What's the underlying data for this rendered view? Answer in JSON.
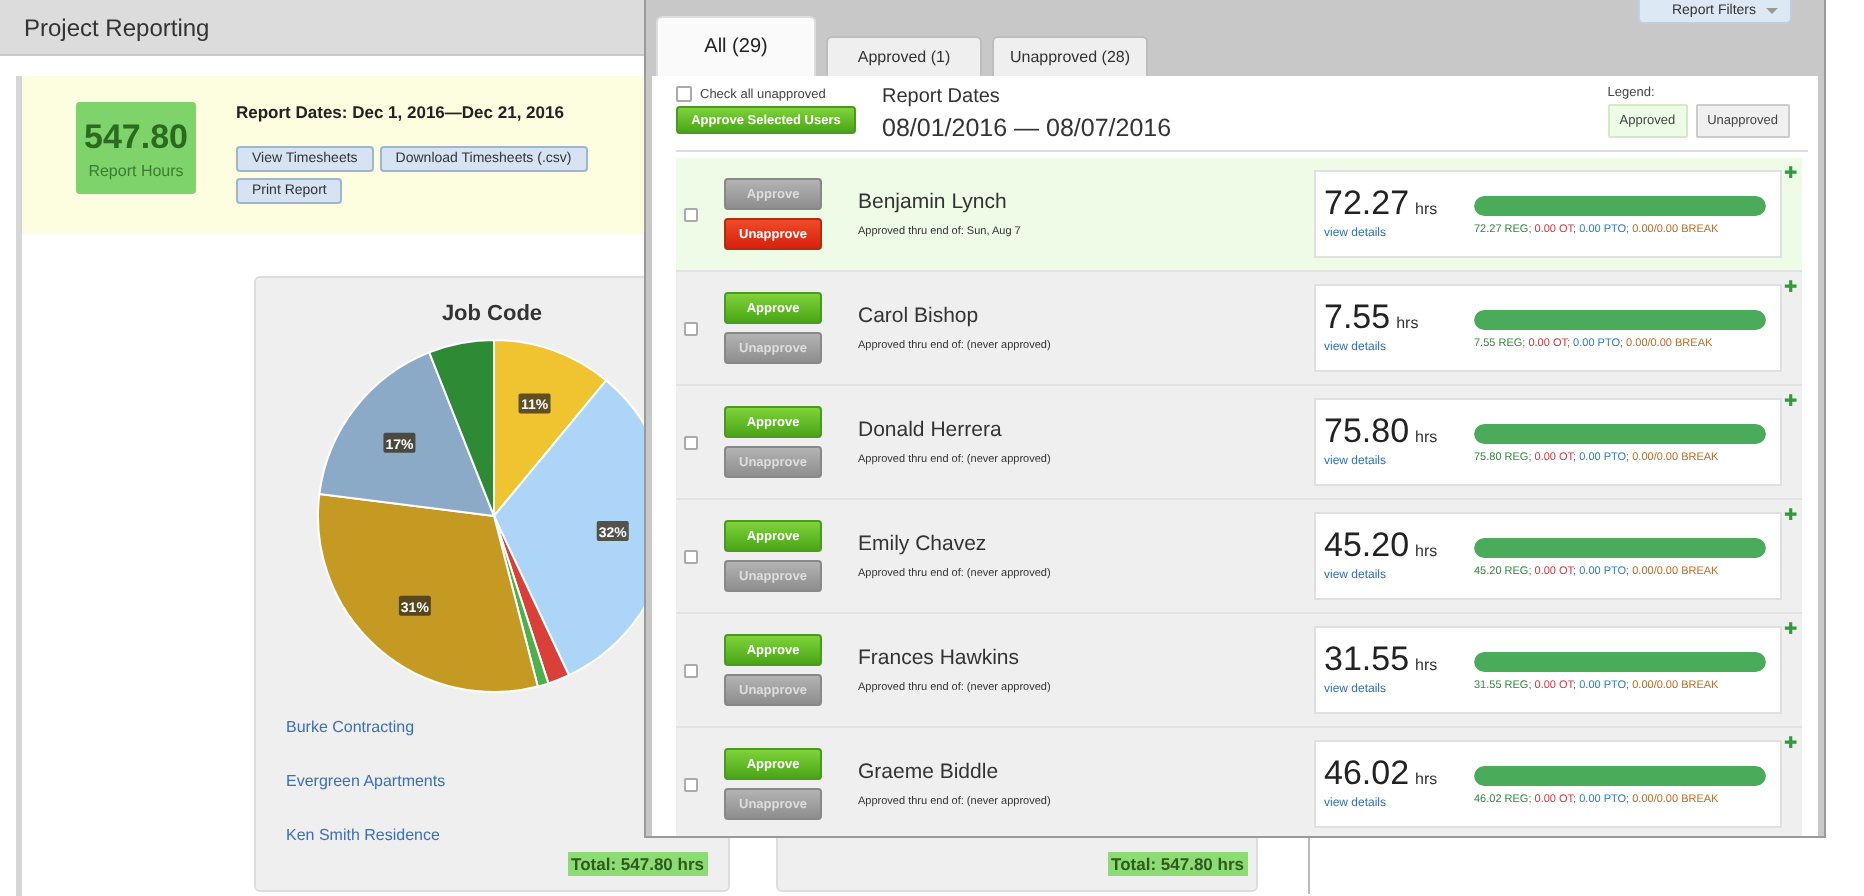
{
  "background": {
    "title": "Project Reporting",
    "summary": {
      "hours": "547.80",
      "hours_label": "Report Hours",
      "dates": "Report Dates: Dec 1, 2016—Dec 21, 2016",
      "buttons": [
        "View Timesheets",
        "Download Timesheets (.csv)",
        "Print Report"
      ]
    },
    "job_code_card": {
      "chart_data": {
        "type": "pie",
        "title": "Job Code",
        "values": [
          11,
          32,
          2,
          1,
          31,
          17,
          6
        ],
        "colors": [
          "#f0c330",
          "#acd5f7",
          "#d9403a",
          "#4cb04c",
          "#c49a22",
          "#8aaac8",
          "#2f8a35"
        ],
        "value_labels": [
          "11%",
          "32%",
          null,
          null,
          "31%",
          "17%",
          null
        ]
      },
      "legend": [
        "Burke Contracting",
        "Evergreen Apartments",
        "Ken Smith Residence"
      ],
      "total": "Total: 547.80 hrs"
    },
    "second_card": {
      "total": "Total: 547.80 hrs"
    }
  },
  "panel": {
    "filters_button": "Report Filters",
    "tabs": [
      {
        "label": "All (29)",
        "selected": true
      },
      {
        "label": "Approved (1)",
        "selected": false
      },
      {
        "label": "Unapproved (28)",
        "selected": false
      }
    ],
    "check_all": {
      "label": "Check all unapproved",
      "checked": false
    },
    "approve_selected": "Approve Selected Users",
    "report_dates_label": "Report Dates",
    "report_dates": "08/01/2016 — 08/07/2016",
    "legend": {
      "label": "Legend:",
      "items": [
        {
          "kind": "approved",
          "label": "Approved"
        },
        {
          "kind": "unapproved",
          "label": "Unapproved"
        }
      ]
    },
    "rows": [
      {
        "name": "Benjamin Lynch",
        "status": "Approved thru end of: Sun, Aug 7",
        "approved": true,
        "checked": false,
        "approve": "Approve",
        "unapprove": "Unapprove",
        "hours": "72.27",
        "unit": "hrs",
        "link": "view details",
        "level": 1,
        "breakdown": [
          {
            "kind": "reg",
            "text": "72.27 REG;"
          },
          {
            "kind": "ot",
            "text": "0.00 OT;"
          },
          {
            "kind": "pto",
            "text": "0.00 PTO;"
          },
          {
            "kind": "break",
            "text": "0.00/0.00 BREAK"
          }
        ],
        "plus": "✚"
      },
      {
        "name": "Carol Bishop",
        "status": "Approved thru end of: (never approved)",
        "approved": false,
        "checked": false,
        "approve": "Approve",
        "unapprove": "Unapprove",
        "hours": "7.55",
        "unit": "hrs",
        "link": "view details",
        "level": 1,
        "breakdown": [
          {
            "kind": "reg",
            "text": "7.55 REG;"
          },
          {
            "kind": "ot",
            "text": "0.00 OT;"
          },
          {
            "kind": "pto",
            "text": "0.00 PTO;"
          },
          {
            "kind": "break",
            "text": "0.00/0.00 BREAK"
          }
        ],
        "plus": "✚"
      },
      {
        "name": "Donald Herrera",
        "status": "Approved thru end of: (never approved)",
        "approved": false,
        "checked": false,
        "approve": "Approve",
        "unapprove": "Unapprove",
        "hours": "75.80",
        "unit": "hrs",
        "link": "view details",
        "level": 1,
        "breakdown": [
          {
            "kind": "reg",
            "text": "75.80 REG;"
          },
          {
            "kind": "ot",
            "text": "0.00 OT;"
          },
          {
            "kind": "pto",
            "text": "0.00 PTO;"
          },
          {
            "kind": "break",
            "text": "0.00/0.00 BREAK"
          }
        ],
        "plus": "✚"
      },
      {
        "name": "Emily Chavez",
        "status": "Approved thru end of: (never approved)",
        "approved": false,
        "checked": false,
        "approve": "Approve",
        "unapprove": "Unapprove",
        "hours": "45.20",
        "unit": "hrs",
        "link": "view details",
        "level": 1,
        "breakdown": [
          {
            "kind": "reg",
            "text": "45.20 REG;"
          },
          {
            "kind": "ot",
            "text": "0.00 OT;"
          },
          {
            "kind": "pto",
            "text": "0.00 PTO;"
          },
          {
            "kind": "break",
            "text": "0.00/0.00 BREAK"
          }
        ],
        "plus": "✚"
      },
      {
        "name": "Frances Hawkins",
        "status": "Approved thru end of: (never approved)",
        "approved": false,
        "checked": false,
        "approve": "Approve",
        "unapprove": "Unapprove",
        "hours": "31.55",
        "unit": "hrs",
        "link": "view details",
        "level": 1,
        "breakdown": [
          {
            "kind": "reg",
            "text": "31.55 REG;"
          },
          {
            "kind": "ot",
            "text": "0.00 OT;"
          },
          {
            "kind": "pto",
            "text": "0.00 PTO;"
          },
          {
            "kind": "break",
            "text": "0.00/0.00 BREAK"
          }
        ],
        "plus": "✚"
      },
      {
        "name": "Graeme Biddle",
        "status": "Approved thru end of: (never approved)",
        "approved": false,
        "checked": false,
        "approve": "Approve",
        "unapprove": "Unapprove",
        "hours": "46.02",
        "unit": "hrs",
        "link": "view details",
        "level": 1,
        "breakdown": [
          {
            "kind": "reg",
            "text": "46.02 REG;"
          },
          {
            "kind": "ot",
            "text": "0.00 OT;"
          },
          {
            "kind": "pto",
            "text": "0.00 PTO;"
          },
          {
            "kind": "break",
            "text": "0.00/0.00 BREAK"
          }
        ],
        "plus": "✚"
      }
    ]
  }
}
